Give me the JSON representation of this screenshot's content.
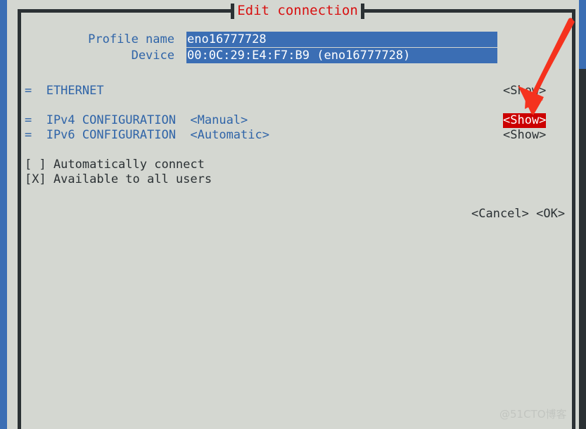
{
  "window": {
    "title": "Edit connection",
    "title_color": "#d81010",
    "background": "#d4d7d1",
    "frame_color": "#2b3134",
    "accent_blue": "#3b6eb4",
    "label_blue": "#2f64a8",
    "highlight_red": "#cc0000"
  },
  "fields": [
    {
      "label": "Profile name",
      "value": "eno16777728"
    },
    {
      "label": "Device",
      "value": "00:0C:29:E4:F7:B9 (eno16777728)"
    }
  ],
  "sections": [
    {
      "marker": "=",
      "name": "ETHERNET",
      "mode": "",
      "show_label": "<Show>",
      "selected": false
    },
    {
      "marker": "=",
      "name": "IPv4 CONFIGURATION",
      "mode": "<Manual>",
      "show_label": "<Show>",
      "selected": true
    },
    {
      "marker": "=",
      "name": "IPv6 CONFIGURATION",
      "mode": "<Automatic>",
      "show_label": "<Show>",
      "selected": false
    }
  ],
  "section_lines": {
    "ethernet": "=  ETHERNET",
    "ipv4": "=  IPv4 CONFIGURATION  <Manual>",
    "ipv6": "=  IPv6 CONFIGURATION  <Automatic>"
  },
  "checkboxes": [
    {
      "box": "[ ]",
      "checked": false,
      "label": "Automatically connect",
      "line": "[ ] Automatically connect"
    },
    {
      "box": "[X]",
      "checked": true,
      "label": "Available to all users",
      "line": "[X] Available to all users"
    }
  ],
  "buttons": {
    "cancel": "<Cancel>",
    "ok": "<OK>",
    "line": "<Cancel> <OK>"
  },
  "annotation": {
    "arrow_color": "#f5321e",
    "points_at": "<Show>"
  },
  "watermark": "@51CTO博客"
}
